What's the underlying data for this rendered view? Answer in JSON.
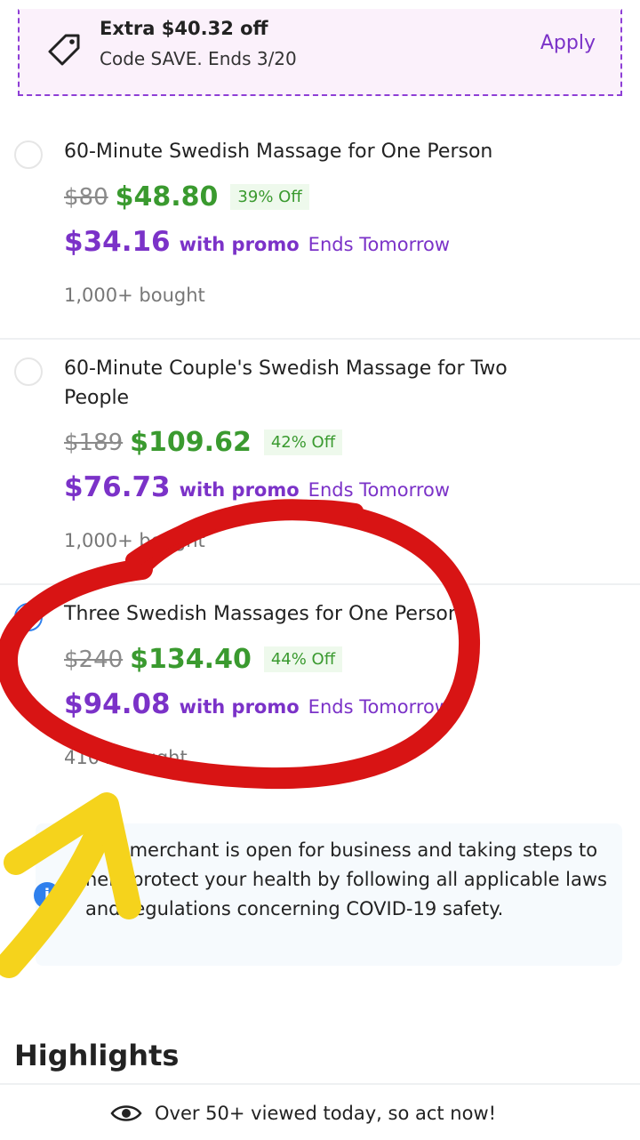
{
  "promo": {
    "title": "Extra $40.32 off",
    "subtitle": "Code SAVE. Ends 3/20",
    "apply_label": "Apply",
    "icon": "tag-icon"
  },
  "options": [
    {
      "title": "60-Minute Swedish Massage for One Person",
      "original_price": "$80",
      "sale_price": "$48.80",
      "discount": "39% Off",
      "promo_price": "$34.16",
      "with_promo": "with promo",
      "ends": "Ends Tomorrow",
      "bought": "1,000+ bought",
      "selected": false
    },
    {
      "title": "60-Minute Couple's Swedish Massage for Two People",
      "original_price": "$189",
      "sale_price": "$109.62",
      "discount": "42% Off",
      "promo_price": "$76.73",
      "with_promo": "with promo",
      "ends": "Ends Tomorrow",
      "bought": "1,000+ bought",
      "selected": false
    },
    {
      "title": "Three Swedish Massages for One Person",
      "original_price": "$240",
      "sale_price": "$134.40",
      "discount": "44% Off",
      "promo_price": "$94.08",
      "with_promo": "with promo",
      "ends": "Ends Tomorrow",
      "bought": "410+ bought",
      "selected": true
    }
  ],
  "covid_notice": {
    "icon": "info-icon",
    "text": "This merchant is open for business and taking steps to help protect your health by following all applicable laws and regulations concerning COVID-19 safety."
  },
  "highlights_heading": "Highlights",
  "viewed": {
    "icon": "eye-icon",
    "text": "Over 50+ viewed today, so act now!"
  },
  "colors": {
    "accent_purple": "#7b32c8",
    "sale_green": "#3a9a2f",
    "selected_blue": "#2f80ed",
    "annotation_red": "#d81414",
    "annotation_yellow": "#f5d31c"
  }
}
